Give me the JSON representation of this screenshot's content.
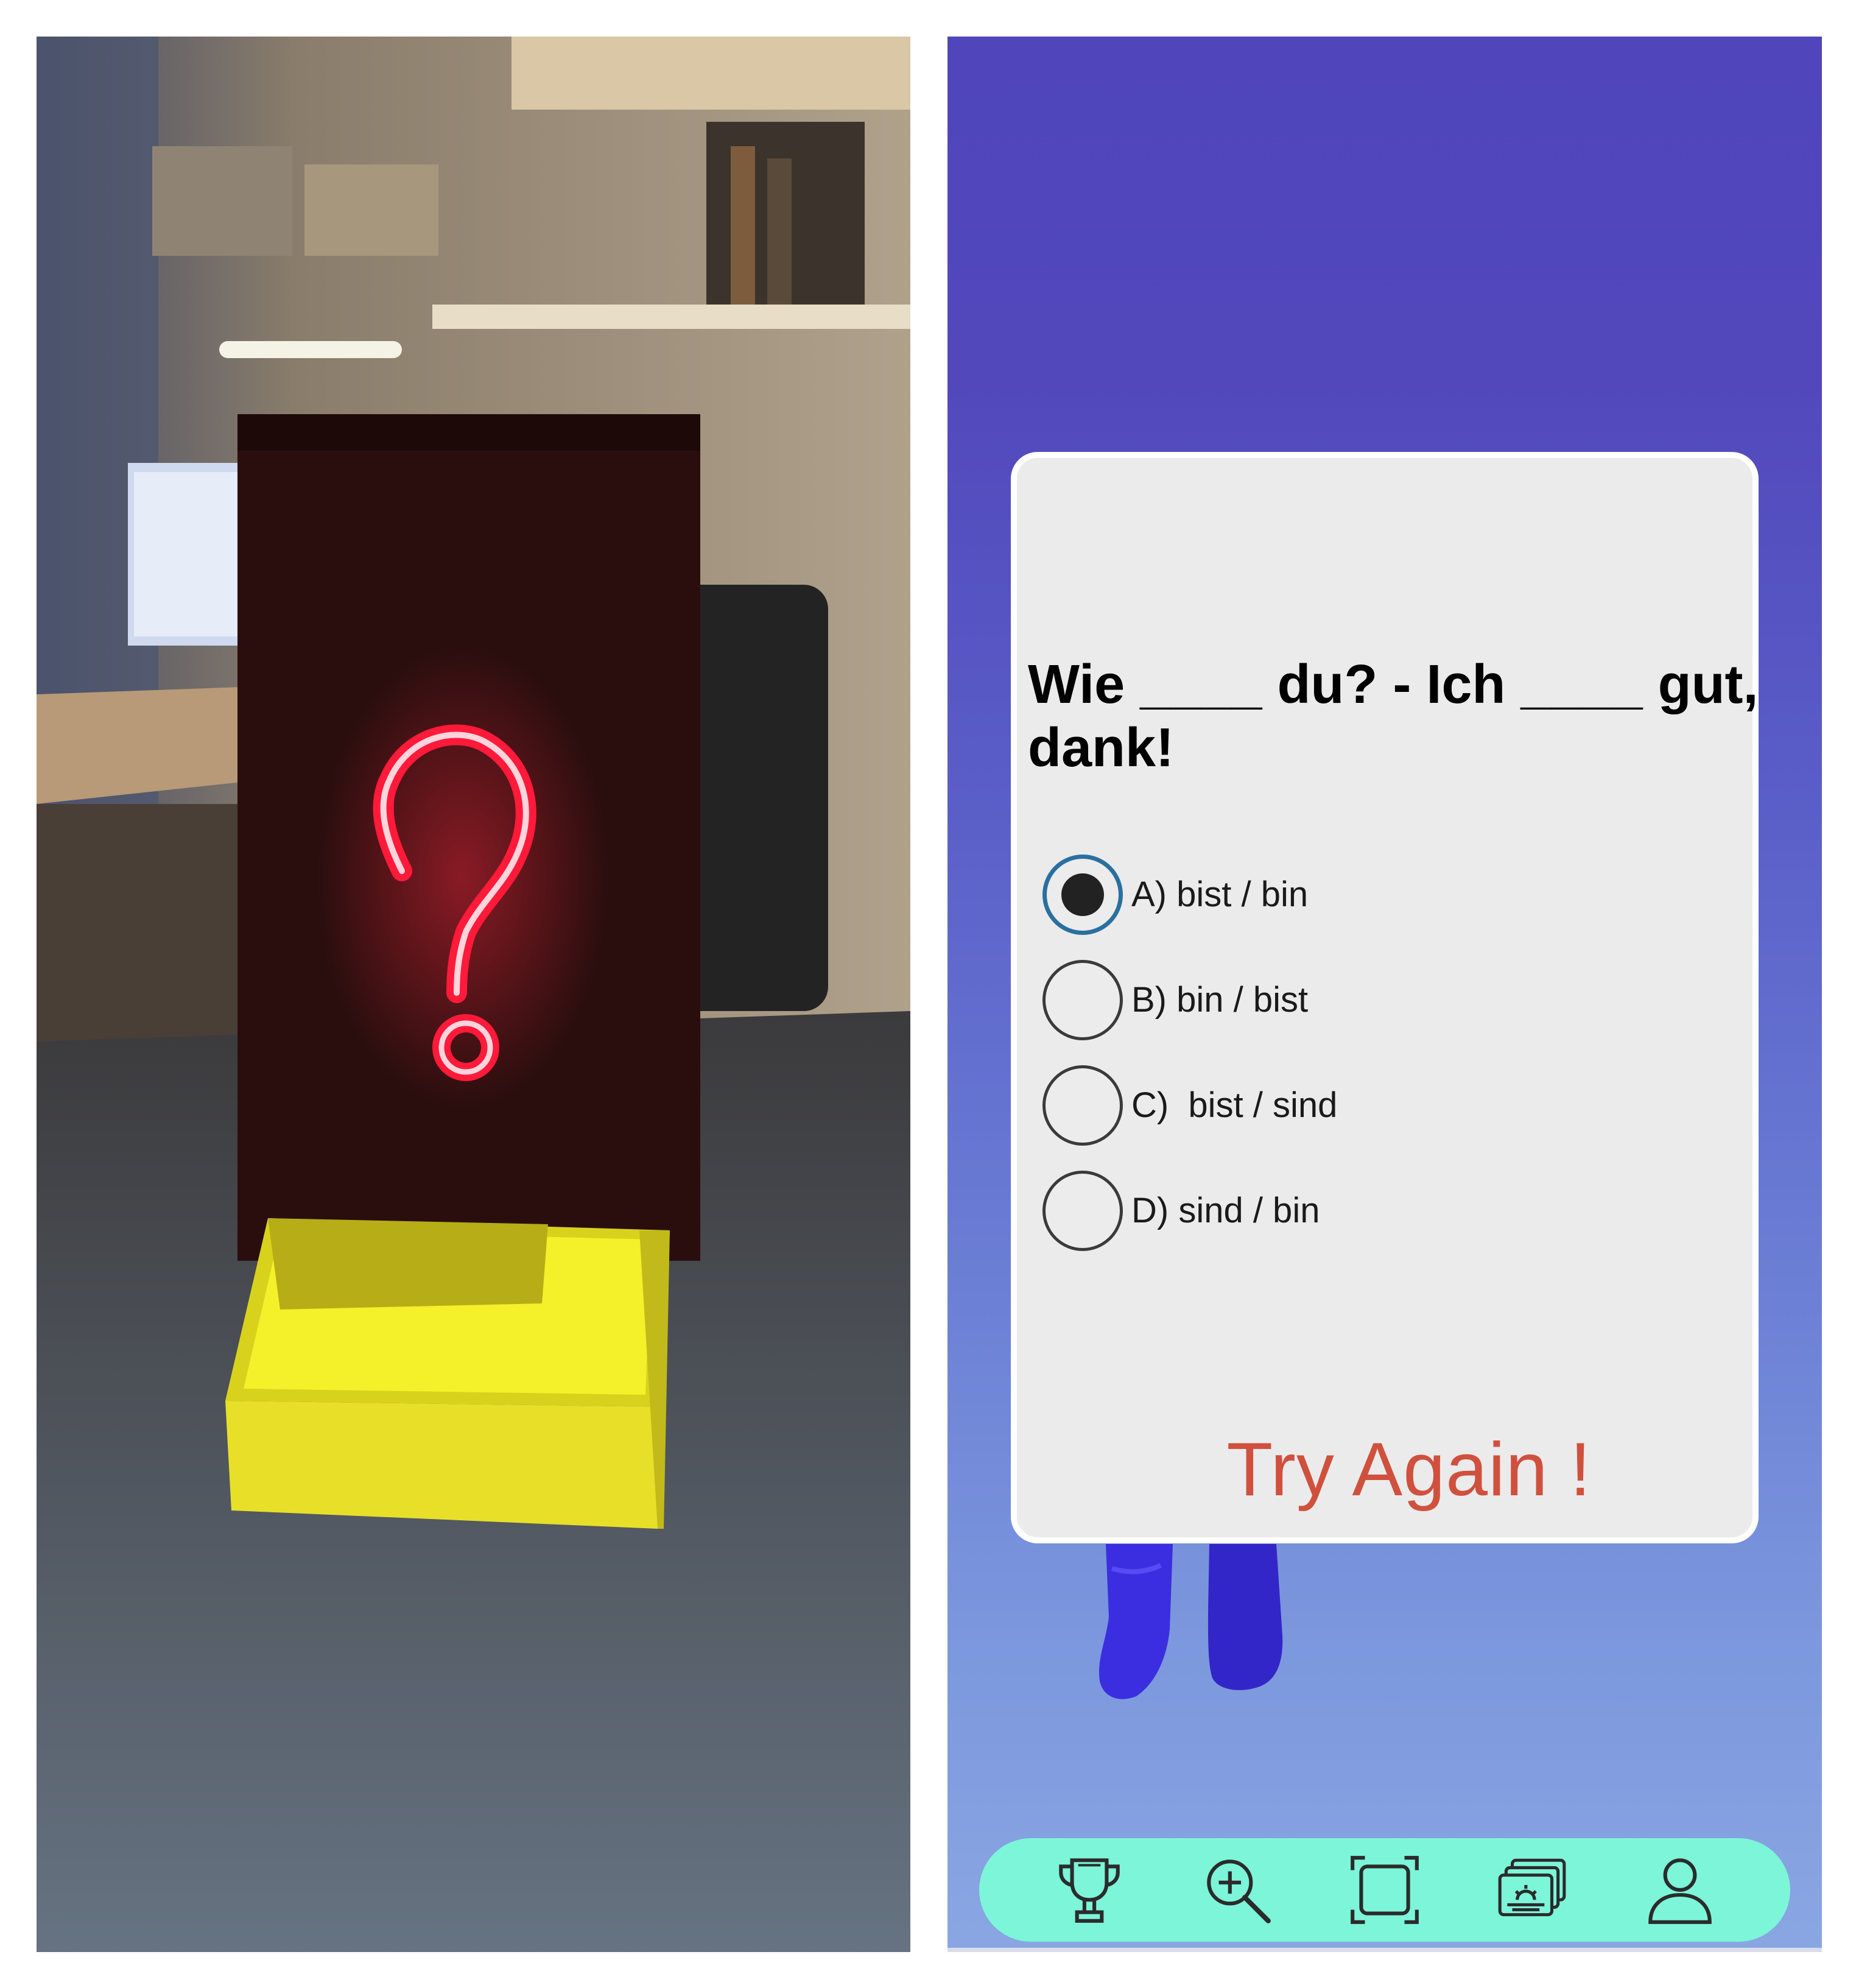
{
  "quiz": {
    "question": "Wie ____ du? - Ich ____ gut, dank!",
    "options": [
      {
        "label": "A) bist / bin",
        "selected": true
      },
      {
        "label": "B) bin / bist",
        "selected": false
      },
      {
        "label": "C)  bist / sind",
        "selected": false
      },
      {
        "label": "D) sind / bin",
        "selected": false
      }
    ],
    "feedback": "Try Again !",
    "feedback_color": "#d0503e"
  },
  "ar_view": {
    "board_symbol": "?",
    "board_color": "#2a0e0e",
    "neon_color": "#ff1a3a",
    "box_color": "#f4f02a"
  },
  "bottom_nav": {
    "items": [
      {
        "icon": "trophy-icon"
      },
      {
        "icon": "zoom-in-icon"
      },
      {
        "icon": "scan-frame-icon"
      },
      {
        "icon": "gallery-icon"
      },
      {
        "icon": "profile-icon"
      }
    ],
    "background": "#7cf5d9"
  },
  "colors": {
    "background_top": "#5045bb",
    "background_bottom": "#8aa6e2",
    "card": "#ebebeb",
    "radio_selected_ring": "#2a6fa0"
  }
}
